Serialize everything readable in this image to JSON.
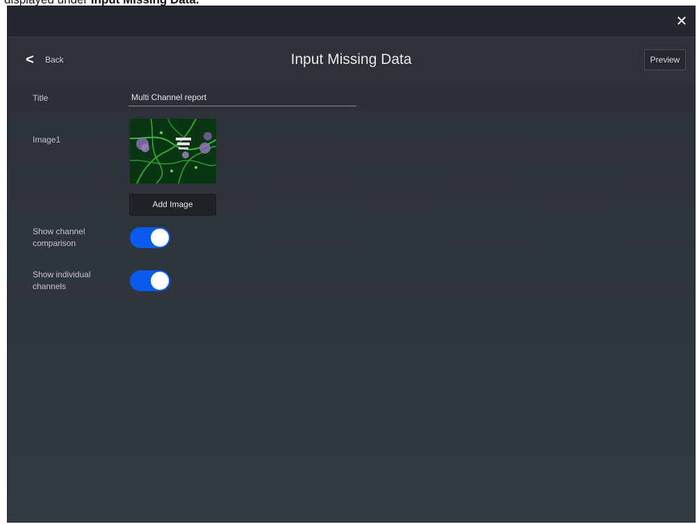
{
  "caption": {
    "prefix": "displayed under ",
    "bold": "Input Missing Data."
  },
  "titlebar": {
    "close_icon": "close-icon"
  },
  "header": {
    "back_label": "Back",
    "back_icon": "chevron-left-icon",
    "title": "Input Missing Data",
    "preview_label": "Preview"
  },
  "form": {
    "title_label": "Title",
    "title_value": "Multi Channel report",
    "image_label": "Image1",
    "add_image_label": "Add Image",
    "channel_comparison_label": "Show channel comparison",
    "channel_comparison_on": true,
    "individual_channels_label": "Show individual channels",
    "individual_channels_on": true
  },
  "colors": {
    "toggle_on": "#0a5cf0",
    "background": "#2f353c"
  }
}
